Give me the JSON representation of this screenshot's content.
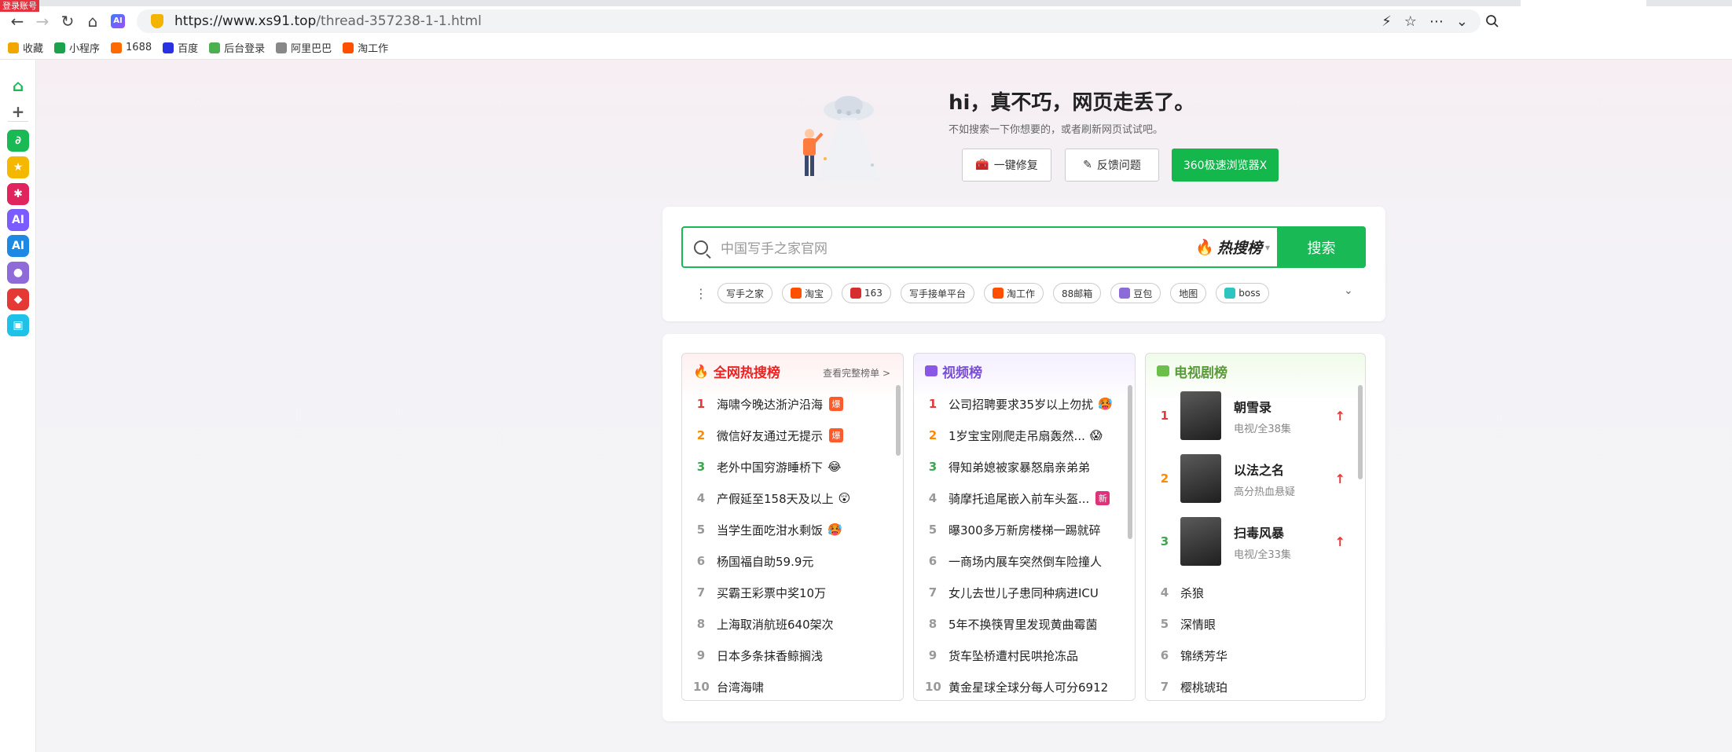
{
  "browser": {
    "login_badge": "登录账号",
    "url_domain": "https://www.xs91.top",
    "url_path": "/thread-357238-1-1.html",
    "bookmarks": [
      {
        "label": "收藏",
        "color": "#f2a600"
      },
      {
        "label": "小程序",
        "color": "#1aa34a"
      },
      {
        "label": "1688",
        "color": "#ff6a00"
      },
      {
        "label": "百度",
        "color": "#2932e1"
      },
      {
        "label": "后台登录",
        "color": "#4caf50"
      },
      {
        "label": "阿里巴巴",
        "color": "#888888"
      },
      {
        "label": "淘工作",
        "color": "#ff5000"
      }
    ],
    "sidebar_apps": [
      {
        "name": "home",
        "color": "#ffffff"
      },
      {
        "name": "add",
        "color": "#ffffff"
      },
      {
        "name": "miniprogram",
        "color": "#19b955"
      },
      {
        "name": "favorites",
        "color": "#f5b800"
      },
      {
        "name": "molecule",
        "color": "#e0245e"
      },
      {
        "name": "ai-assistant",
        "color": "#7b5cff"
      },
      {
        "name": "ai",
        "color": "#1e88e5"
      },
      {
        "name": "robot",
        "color": "#8e6bd8"
      },
      {
        "name": "game",
        "color": "#e53935"
      },
      {
        "name": "tools",
        "color": "#1ec1e8"
      }
    ]
  },
  "error": {
    "title": "hi，真不巧，网页走丢了。",
    "subtitle": "不如搜索一下你想要的，或者刷新网页试试吧。",
    "repair_label": "一键修复",
    "feedback_label": "反馈问题",
    "browser_label": "360极速浏览器X"
  },
  "search": {
    "placeholder": "中国写手之家官网",
    "hot_label": "热搜榜",
    "button_label": "搜索",
    "chips": [
      {
        "label": "写手之家",
        "color": ""
      },
      {
        "label": "淘宝",
        "color": "#ff5000"
      },
      {
        "label": "163",
        "color": "#d62e2e"
      },
      {
        "label": "写手接单平台",
        "color": ""
      },
      {
        "label": "淘工作",
        "color": "#ff5000"
      },
      {
        "label": "88邮箱",
        "color": ""
      },
      {
        "label": "豆包",
        "color": "#8a6bd8"
      },
      {
        "label": "地图",
        "color": ""
      },
      {
        "label": "boss",
        "color": "#2ec5c0"
      }
    ]
  },
  "hot_list": {
    "title": "全网热搜榜",
    "more": "查看完整榜单 >",
    "items": [
      {
        "rank": "1",
        "text": "海啸今晚达浙沪沿海",
        "tag": "爆",
        "emoji": ""
      },
      {
        "rank": "2",
        "text": "微信好友通过无提示",
        "tag": "爆",
        "emoji": ""
      },
      {
        "rank": "3",
        "text": "老外中国穷游睡桥下",
        "tag": "",
        "emoji": "😂"
      },
      {
        "rank": "4",
        "text": "产假延至158天及以上",
        "tag": "",
        "emoji": "😲"
      },
      {
        "rank": "5",
        "text": "当学生面吃泔水剩饭",
        "tag": "",
        "emoji": "🥵"
      },
      {
        "rank": "6",
        "text": "杨国福自助59.9元",
        "tag": "",
        "emoji": ""
      },
      {
        "rank": "7",
        "text": "买霸王彩票中奖10万",
        "tag": "",
        "emoji": ""
      },
      {
        "rank": "8",
        "text": "上海取消航班640架次",
        "tag": "",
        "emoji": ""
      },
      {
        "rank": "9",
        "text": "日本多条抹香鲸搁浅",
        "tag": "",
        "emoji": ""
      },
      {
        "rank": "10",
        "text": "台湾海啸",
        "tag": "",
        "emoji": ""
      }
    ]
  },
  "video_list": {
    "title": "视频榜",
    "items": [
      {
        "rank": "1",
        "text": "公司招聘要求35岁以上勿扰",
        "tag": "",
        "emoji": "🥵"
      },
      {
        "rank": "2",
        "text": "1岁宝宝刚爬走吊扇轰然...",
        "tag": "",
        "emoji": "😱"
      },
      {
        "rank": "3",
        "text": "得知弟媳被家暴怒扇亲弟弟",
        "tag": "",
        "emoji": ""
      },
      {
        "rank": "4",
        "text": "骑摩托追尾嵌入前车头盔...",
        "tag": "新",
        "emoji": ""
      },
      {
        "rank": "5",
        "text": "曝300多万新房楼梯一踢就碎",
        "tag": "",
        "emoji": ""
      },
      {
        "rank": "6",
        "text": "一商场内展车突然倒车险撞人",
        "tag": "",
        "emoji": ""
      },
      {
        "rank": "7",
        "text": "女儿去世儿子患同种病进ICU",
        "tag": "",
        "emoji": ""
      },
      {
        "rank": "8",
        "text": "5年不换筷胃里发现黄曲霉菌",
        "tag": "",
        "emoji": ""
      },
      {
        "rank": "9",
        "text": "货车坠桥遭村民哄抢冻品",
        "tag": "",
        "emoji": ""
      },
      {
        "rank": "10",
        "text": "黄金星球全球分每人可分6912",
        "tag": "",
        "emoji": ""
      }
    ]
  },
  "tv_list": {
    "title": "电视剧榜",
    "top": [
      {
        "rank": "1",
        "name": "朝雪录",
        "desc": "电视/全38集"
      },
      {
        "rank": "2",
        "name": "以法之名",
        "desc": "高分热血悬疑"
      },
      {
        "rank": "3",
        "name": "扫毒风暴",
        "desc": "电视/全33集"
      }
    ],
    "items": [
      {
        "rank": "4",
        "text": "杀狼"
      },
      {
        "rank": "5",
        "text": "深情眼"
      },
      {
        "rank": "6",
        "text": "锦绣芳华"
      },
      {
        "rank": "7",
        "text": "樱桃琥珀"
      }
    ]
  },
  "colors": {
    "accent": "#19b955",
    "rank1": "#e33b3b",
    "rank2": "#ff8a00",
    "rank3": "#3aa84a",
    "hot_tag": "#ff5a2a",
    "new_tag": "#e0317b"
  }
}
